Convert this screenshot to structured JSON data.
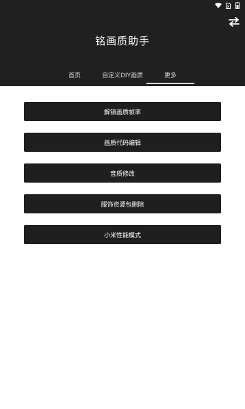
{
  "app": {
    "title": "铭画质助手"
  },
  "status_bar": {
    "icons": [
      "wifi-icon",
      "sim-icon",
      "battery-icon"
    ]
  },
  "header": {
    "action_icon": "swap-icon"
  },
  "tabs": [
    {
      "label": "首页",
      "selected": false
    },
    {
      "label": "自定义DIY画质",
      "selected": false
    },
    {
      "label": "更多",
      "selected": true
    }
  ],
  "menu": {
    "items": [
      {
        "label": "解锁画质帧率"
      },
      {
        "label": "画质代码编辑"
      },
      {
        "label": "音质修改"
      },
      {
        "label": "服饰资源包删除"
      },
      {
        "label": "小米性能模式"
      }
    ]
  },
  "colors": {
    "appbar": "#202020",
    "button": "#1f1f1f",
    "text_on_dark": "#ffffff",
    "background": "#ffffff"
  }
}
